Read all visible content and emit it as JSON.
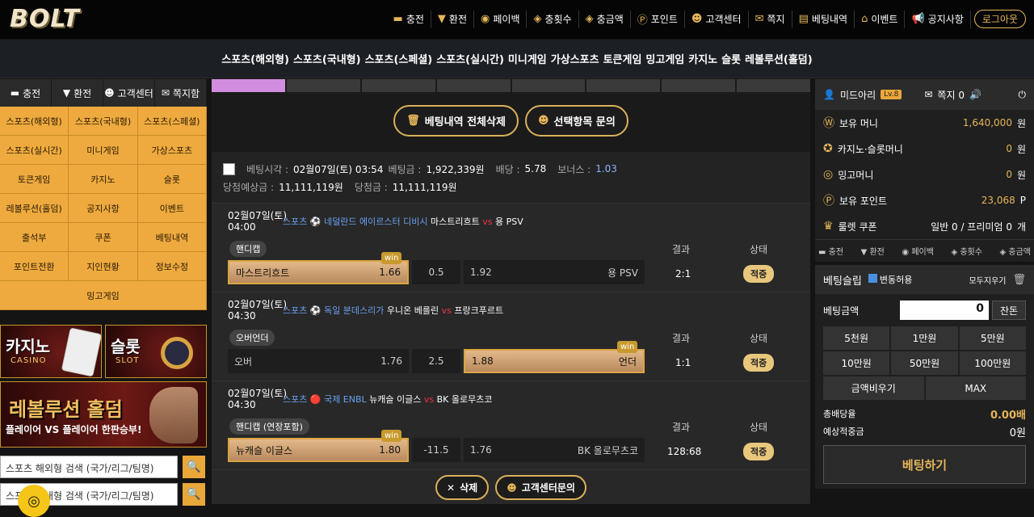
{
  "logo": "BOLT",
  "topnav": [
    {
      "icon": "▬",
      "label": "충전"
    },
    {
      "icon": "▼",
      "label": "환전"
    },
    {
      "icon": "◉",
      "label": "페이백"
    },
    {
      "icon": "◈",
      "label": "충횟수"
    },
    {
      "icon": "◈",
      "label": "충금액"
    },
    {
      "icon": "Ⓟ",
      "label": "포인트"
    },
    {
      "icon": "☻",
      "label": "고객센터"
    },
    {
      "icon": "✉",
      "label": "쪽지"
    },
    {
      "icon": "▤",
      "label": "베팅내역"
    },
    {
      "icon": "⌂",
      "label": "이벤트"
    },
    {
      "icon": "📢",
      "label": "공지사항"
    }
  ],
  "logout": "로그아웃",
  "menubar": [
    "스포츠(해외형)",
    "스포츠(국내형)",
    "스포츠(스페셜)",
    "스포츠(실시간)",
    "미니게임",
    "가상스포츠",
    "토큰게임",
    "밍고게임",
    "카지노",
    "슬롯",
    "레볼루션(홀덤)"
  ],
  "left": {
    "tabs": [
      "충전",
      "환전",
      "고객센터",
      "쪽지함"
    ],
    "grid": [
      "스포츠(해외형)",
      "스포츠(국내형)",
      "스포츠(스페셜)",
      "스포츠(실시간)",
      "미니게임",
      "가상스포츠",
      "토큰게임",
      "카지노",
      "슬롯",
      "레볼루션(홀덤)",
      "공지사항",
      "이벤트",
      "출석부",
      "쿠폰",
      "베팅내역",
      "포인트전환",
      "지인현황",
      "정보수정",
      "밍고게임"
    ],
    "casino_title": "카지노",
    "casino_sub": "CASINO",
    "slot_title": "슬롯",
    "slot_sub": "SLOT",
    "rev_title": "레볼루션 홀덤",
    "rev_sub": "플레이어 VS 플레이어 한판승부!",
    "search1": "스포츠 해외형 검색 (국가/리그/팀명)",
    "search2": "스포츠 국내형 검색 (국가/리그/팀명)"
  },
  "center": {
    "del_all": "베팅내역 전체삭제",
    "inquiry": "선택항목 문의",
    "head": {
      "time_label": "베팅시각 :",
      "time": "02월07일(토) 03:54",
      "amt_label": "베팅금 :",
      "amt": "1,922,339원",
      "odds_label": "배당 :",
      "odds": "5.78",
      "bonus_label": "보너스 :",
      "bonus": "1.03",
      "exp_label": "당첨예상금 :",
      "exp": "11,111,119원",
      "won_label": "당첨금 :",
      "won": "11,111,119원"
    },
    "bets": [
      {
        "date": "02월07일(토)",
        "time": "04:00",
        "sport": "스포츠",
        "league": "⚽ 네덜란드 에이르스터 디비시",
        "home": "마스트리흐트",
        "vs": "vs",
        "away": "용 PSV",
        "market": "핸디캡",
        "h_result": "결과",
        "h_status": "상태",
        "left_team": "마스트리흐트",
        "left_odds": "1.66",
        "mid": "0.5",
        "right_odds": "1.92",
        "right_team": "용 PSV",
        "win": "win",
        "result": "2:1",
        "status": "적중"
      },
      {
        "date": "02월07일(토)",
        "time": "04:30",
        "sport": "스포츠",
        "league": "⚽ 독일 분데스리가",
        "home": "우니온 베를린",
        "vs": "vs",
        "away": "프랑크푸르트",
        "market": "오버언더",
        "h_result": "결과",
        "h_status": "상태",
        "left_team": "오버",
        "left_odds": "1.76",
        "mid": "2.5",
        "right_odds": "1.88",
        "right_team": "언더",
        "win": "win",
        "result": "1:1",
        "status": "적중"
      },
      {
        "date": "02월07일(토)",
        "time": "04:30",
        "sport": "스포츠",
        "league": "🔴 국제 ENBL",
        "home": "뉴캐슬 이글스",
        "vs": "vs",
        "away": "BK 올로무츠코",
        "market": "핸디캡 (연장포함)",
        "h_result": "결과",
        "h_status": "상태",
        "left_team": "뉴캐슬 이글스",
        "left_odds": "1.80",
        "mid": "-11.5",
        "right_odds": "1.76",
        "right_team": "BK 올로무츠코",
        "win": "win",
        "result": "128:68",
        "status": "적중"
      }
    ],
    "delete": "삭제",
    "cs": "고객센터문의"
  },
  "right": {
    "user": "미드아리",
    "level": "Lv.8",
    "msg": "쪽지 0",
    "rows": [
      {
        "icon": "Ⓦ",
        "label": "보유 머니",
        "amt": "1,640,000",
        "unit": "원"
      },
      {
        "icon": "✪",
        "label": "카지노·슬롯머니",
        "amt": "0",
        "unit": "원"
      },
      {
        "icon": "◎",
        "label": "밍고머니",
        "amt": "0",
        "unit": "원"
      },
      {
        "icon": "Ⓟ",
        "label": "보유 포인트",
        "amt": "23,068",
        "unit": "P"
      },
      {
        "icon": "♛",
        "label": "룰렛 쿠폰",
        "amt": "일반 0 / 프리미엄 0",
        "unit": "개"
      }
    ],
    "quick": [
      "충전",
      "환전",
      "페이백",
      "충횟수",
      "충금액"
    ],
    "slip_title": "베팅슬립",
    "auto": "변동허용",
    "clear": "모두지우기",
    "amt_label": "베팅금액",
    "amt": "0",
    "zan": "잔돈",
    "keys": [
      "5천원",
      "1만원",
      "5만원",
      "10만원",
      "50만원",
      "100만원"
    ],
    "keys2": [
      "금액비우기",
      "MAX"
    ],
    "total_odds_label": "총배당율",
    "total_odds": "0.00배",
    "expected_label": "예상적중금",
    "expected": "0원",
    "bet_btn": "베팅하기"
  }
}
